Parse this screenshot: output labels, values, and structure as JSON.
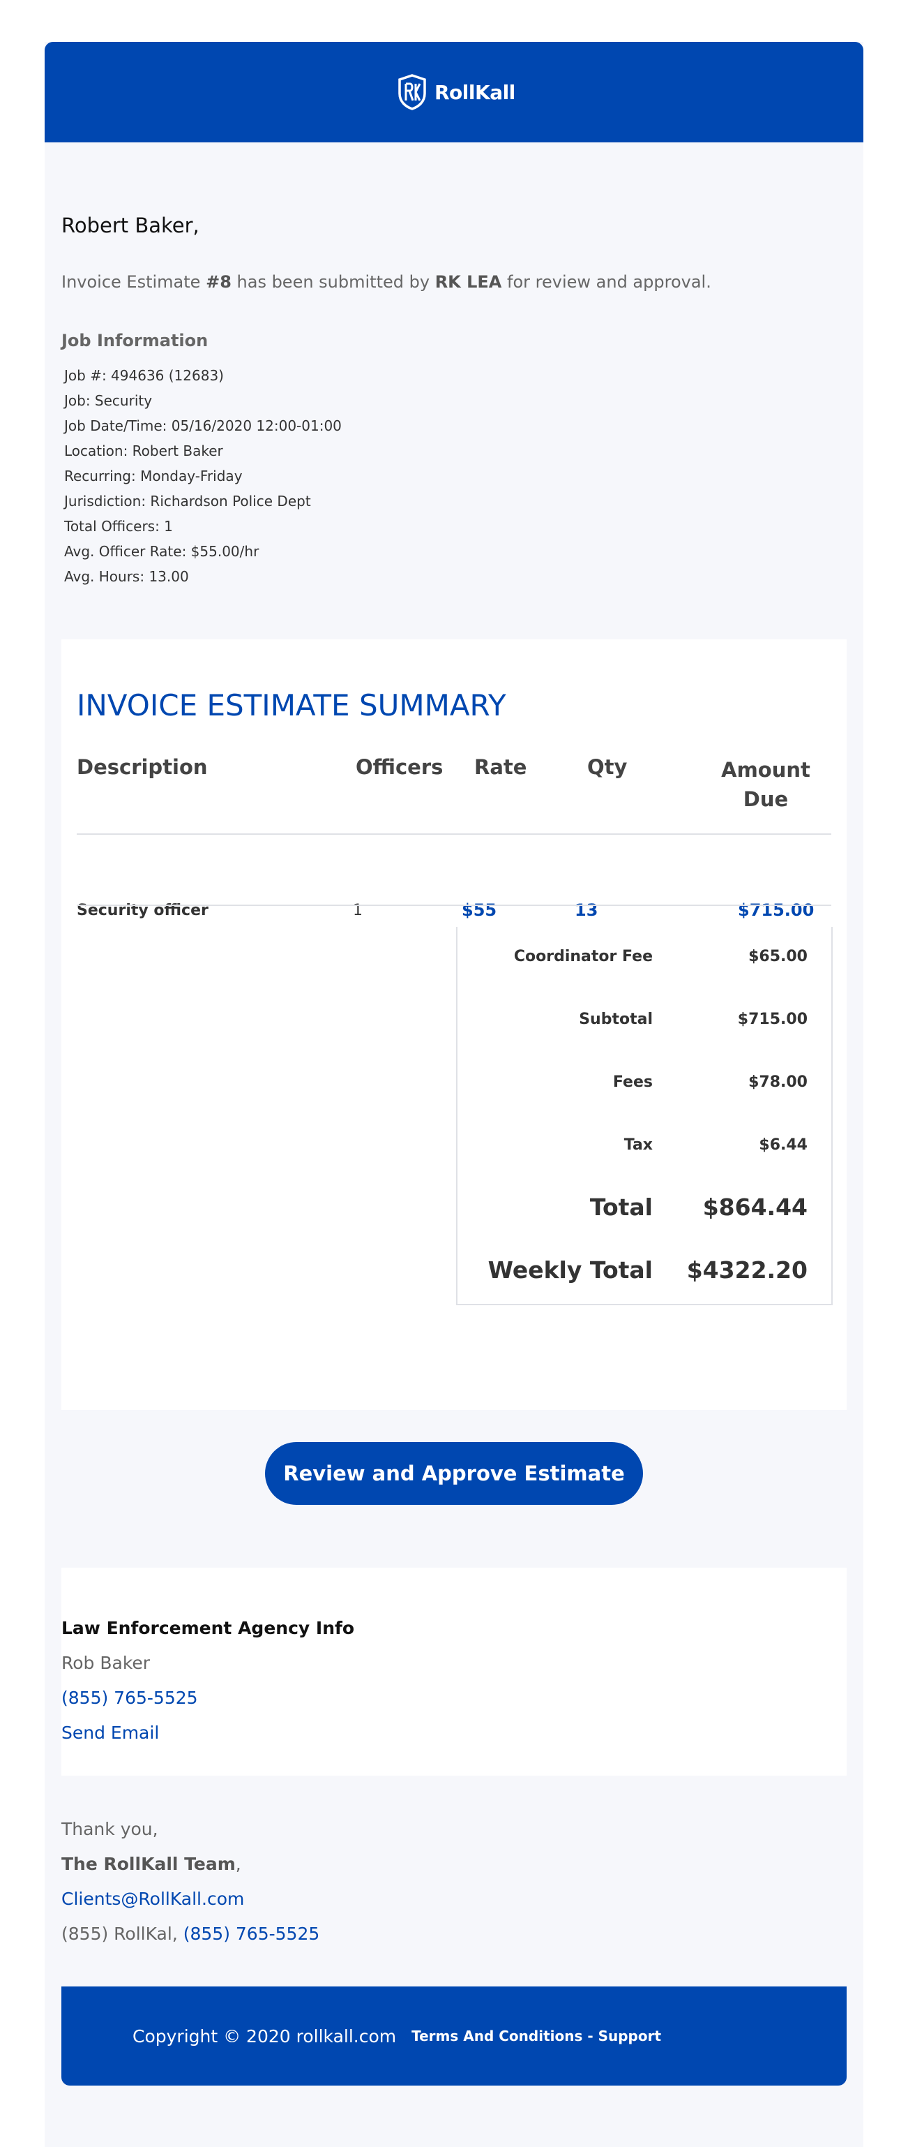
{
  "brand": {
    "name": "RollKall",
    "logo_letters": "RK",
    "color": "#0047b0"
  },
  "greeting": "Robert Baker,",
  "intro": {
    "prefix": "Invoice Estimate ",
    "estimate_number": "#8",
    "middle": " has been submitted by ",
    "agency": "RK LEA",
    "suffix": " for review and approval."
  },
  "job": {
    "title": "Job Information",
    "items": [
      "Job #: 494636 (12683)",
      "Job: Security",
      "Job Date/Time: 05/16/2020 12:00-01:00",
      "Location: Robert Baker",
      "Recurring: Monday-Friday",
      "Jurisdiction: Richardson Police Dept",
      "Total Officers: 1",
      "Avg. Officer Rate: $55.00/hr",
      "Avg. Hours: 13.00"
    ]
  },
  "summary": {
    "title": "INVOICE ESTIMATE SUMMARY",
    "headers": {
      "description": "Description",
      "officers": "Officers",
      "rate": "Rate",
      "qty": "Qty",
      "amount_line1": "Amount",
      "amount_line2": "Due"
    },
    "row": {
      "description": "Security officer",
      "officers": "1",
      "rate": "$55",
      "qty": "13",
      "amount": "$715.00"
    },
    "totals": [
      {
        "label": "Coordinator Fee",
        "value": "$65.00"
      },
      {
        "label": "Subtotal",
        "value": "$715.00"
      },
      {
        "label": "Fees",
        "value": "$78.00"
      },
      {
        "label": "Tax",
        "value": "$6.44"
      },
      {
        "label": "Total",
        "value": "$864.44"
      },
      {
        "label": "Weekly Total",
        "value": "$4322.20"
      }
    ]
  },
  "cta": {
    "label": "Review and Approve Estimate"
  },
  "agency": {
    "title": "Law Enforcement Agency Info",
    "name": "Rob Baker",
    "phone": "(855) 765-5525",
    "email_link": "Send Email"
  },
  "signoff": {
    "thanks": "Thank you,",
    "team": "The RollKall Team",
    "team_suffix": ",",
    "email": "Clients@RollKall.com",
    "phone_label": "(855) RollKal, ",
    "phone": "(855) 765-5525"
  },
  "footer": {
    "copyright": "Copyright © 2020 rollkall.com",
    "links": "Terms And Conditions - Support"
  }
}
